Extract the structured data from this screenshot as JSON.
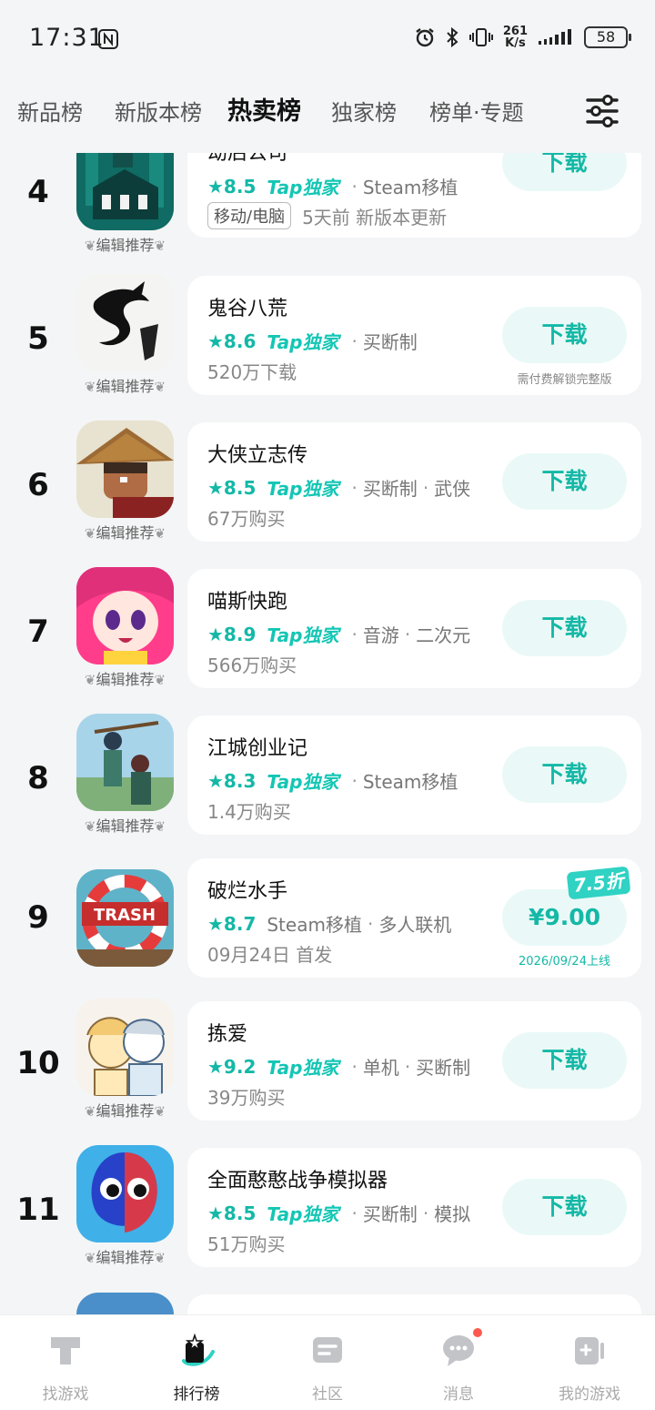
{
  "status_bar": {
    "time": "17:31",
    "net_speed_value": "261",
    "net_speed_unit": "K/s",
    "battery": "58"
  },
  "tabs": [
    {
      "label": "新品榜",
      "active": false
    },
    {
      "label": "新版本榜",
      "active": false
    },
    {
      "label": "热卖榜",
      "active": true
    },
    {
      "label": "独家榜",
      "active": false
    },
    {
      "label": "榜单·专题",
      "active": false
    }
  ],
  "editor_label": "编辑推荐",
  "tap_exclusive_label": "Tap独家",
  "games": [
    {
      "rank": "4",
      "name": "劫后公司",
      "rating": "★8.5",
      "tap": true,
      "tags": [
        "Steam移植"
      ],
      "platform": "移动/电脑",
      "sub": "5天前 新版本更新",
      "button": "下载",
      "note": "",
      "editor": true,
      "icon": "city-ruins-icon"
    },
    {
      "rank": "5",
      "name": "鬼谷八荒",
      "rating": "★8.6",
      "tap": true,
      "tags": [
        "买断制"
      ],
      "platform": "",
      "sub": "520万下载",
      "button": "下载",
      "note": "需付费解锁完整版",
      "editor": true,
      "icon": "dragon-ink-icon"
    },
    {
      "rank": "6",
      "name": "大侠立志传",
      "rating": "★8.5",
      "tap": true,
      "tags": [
        "买断制",
        "武侠"
      ],
      "platform": "",
      "sub": "67万购买",
      "button": "下载",
      "note": "",
      "editor": true,
      "icon": "swordsman-icon"
    },
    {
      "rank": "7",
      "name": "喵斯快跑",
      "rating": "★8.9",
      "tap": true,
      "tags": [
        "音游",
        "二次元"
      ],
      "platform": "",
      "sub": "566万购买",
      "button": "下载",
      "note": "",
      "editor": true,
      "icon": "anime-girl-icon"
    },
    {
      "rank": "8",
      "name": "江城创业记",
      "rating": "★8.3",
      "tap": true,
      "tags": [
        "Steam移植"
      ],
      "platform": "",
      "sub": "1.4万购买",
      "button": "下载",
      "note": "",
      "editor": true,
      "icon": "townsfolk-icon"
    },
    {
      "rank": "9",
      "name": "破烂水手",
      "rating": "★8.7",
      "tap": false,
      "tags": [
        "Steam移植",
        "多人联机"
      ],
      "platform": "",
      "sub": "09月24日 首发",
      "button": "¥9.00",
      "discount": "7.5折",
      "price_note": "2026/09/24上线",
      "note": "",
      "editor": false,
      "icon": "trash-sailors-icon"
    },
    {
      "rank": "10",
      "name": "拣爱",
      "rating": "★9.2",
      "tap": true,
      "tags": [
        "单机",
        "买断制"
      ],
      "platform": "",
      "sub": "39万购买",
      "button": "下载",
      "note": "",
      "editor": true,
      "icon": "sketch-couple-icon"
    },
    {
      "rank": "11",
      "name": "全面憨憨战争模拟器",
      "rating": "★8.5",
      "tap": true,
      "tags": [
        "买断制",
        "模拟"
      ],
      "platform": "",
      "sub": "51万购买",
      "button": "下载",
      "note": "",
      "editor": true,
      "icon": "blob-soldier-icon"
    }
  ],
  "bottom_nav": [
    {
      "label": "找游戏",
      "icon": "find-games-icon",
      "active": false
    },
    {
      "label": "排行榜",
      "icon": "ranking-icon",
      "active": true
    },
    {
      "label": "社区",
      "icon": "community-icon",
      "active": false
    },
    {
      "label": "消息",
      "icon": "message-icon",
      "active": false,
      "badge": true
    },
    {
      "label": "我的游戏",
      "icon": "my-games-icon",
      "active": false
    }
  ],
  "colors": {
    "accent": "#14b8a6",
    "accent_light": "#eaf9f7",
    "background": "#f4f5f6",
    "badge": "#ff5a4f"
  }
}
